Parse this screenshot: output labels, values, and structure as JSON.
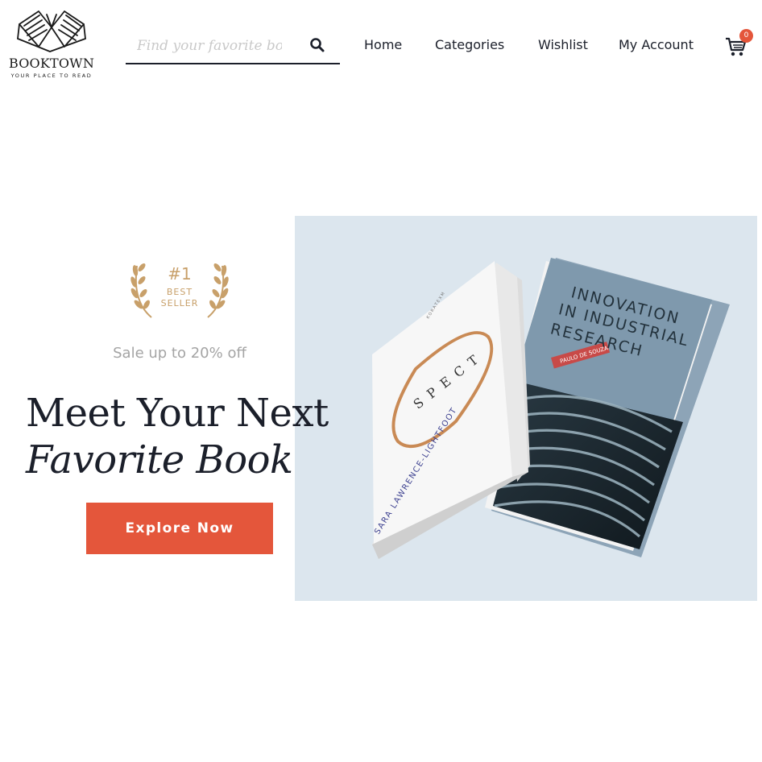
{
  "header": {
    "brand": "BOOKTOWN",
    "tagline": "YOUR PLACE TO READ",
    "search": {
      "placeholder": "Find your favorite book",
      "value": ""
    },
    "nav": [
      "Home",
      "Categories",
      "Wishlist",
      "My Account"
    ],
    "cart_count": "0"
  },
  "hero": {
    "award": {
      "number": "#1",
      "line1": "BEST",
      "line2": "SELLER"
    },
    "sale_text": "Sale up to 20% off",
    "headline_line1": "Meet Your Next",
    "headline_line2": "Favorite Book",
    "cta_label": "Explore Now"
  },
  "books": [
    {
      "title": "SPECT",
      "author": "SARA LAWRENCE-LIGHTFOOT",
      "publisher": "KORATEXM"
    },
    {
      "title": "INNOVATION IN INDUSTRIAL RESEARCH",
      "author": "PAULO DE SOUZA"
    }
  ],
  "colors": {
    "accent": "#e4563b",
    "gold": "#c8a06a",
    "ink": "#1b1f2a",
    "hero_bg": "#dce6ee",
    "muted": "#a4a4a4"
  },
  "icons": [
    "book-logo-icon",
    "search-icon",
    "cart-icon",
    "laurel-left-icon",
    "laurel-right-icon"
  ]
}
